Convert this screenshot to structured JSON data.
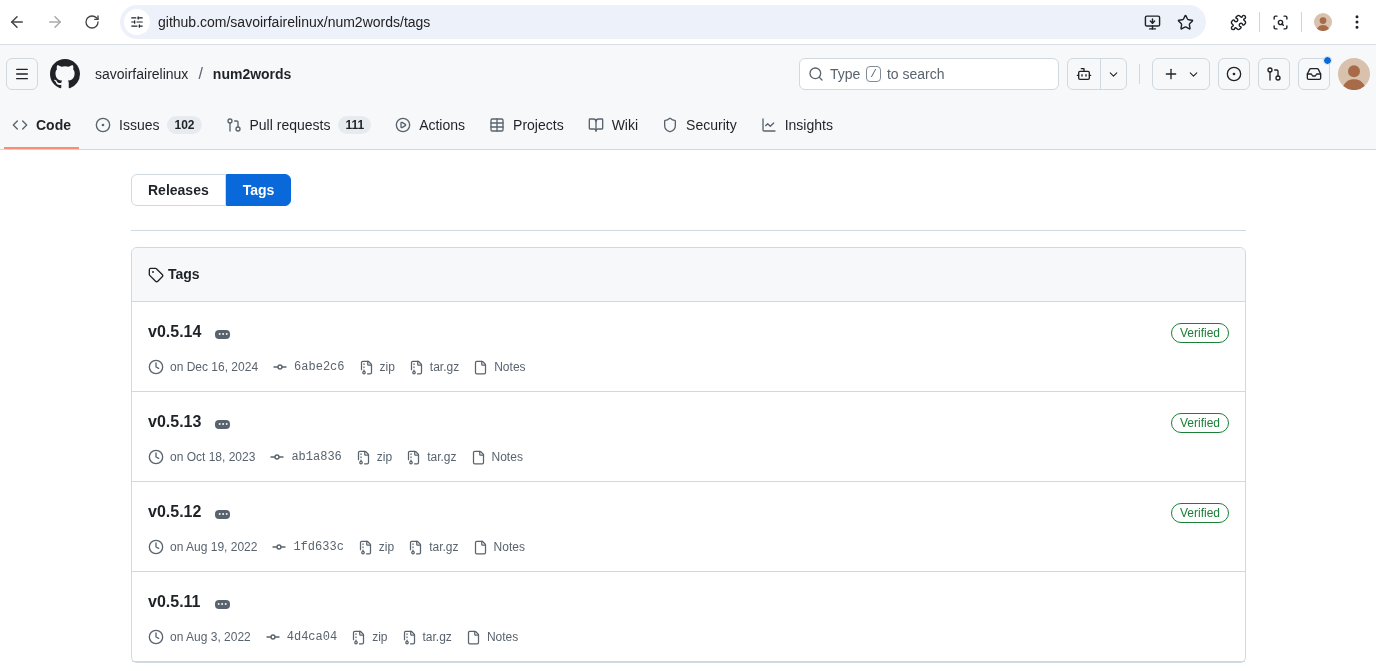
{
  "browser": {
    "url": "github.com/savoirfairelinux/num2words/tags"
  },
  "header": {
    "owner": "savoirfairelinux",
    "separator": "/",
    "repo": "num2words",
    "search": {
      "before": "Type",
      "key": "/",
      "after": "to search"
    },
    "notification_unread": true
  },
  "repo_nav": [
    {
      "kind": "code",
      "label": "Code",
      "selected": true
    },
    {
      "kind": "issues",
      "label": "Issues",
      "count": "102",
      "selected": false
    },
    {
      "kind": "pulls",
      "label": "Pull requests",
      "count": "111",
      "selected": false
    },
    {
      "kind": "actions",
      "label": "Actions",
      "selected": false
    },
    {
      "kind": "projects",
      "label": "Projects",
      "selected": false
    },
    {
      "kind": "wiki",
      "label": "Wiki",
      "selected": false
    },
    {
      "kind": "security",
      "label": "Security",
      "selected": false
    },
    {
      "kind": "insights",
      "label": "Insights",
      "selected": false
    }
  ],
  "toggle": [
    {
      "label": "Releases",
      "selected": false
    },
    {
      "label": "Tags",
      "selected": true
    }
  ],
  "panel": {
    "title": "Tags"
  },
  "tags": [
    {
      "name": "v0.5.14",
      "date": "on Dec 16, 2024",
      "commit": "6abe2c6",
      "zip": "zip",
      "tar": "tar.gz",
      "notes": "Notes",
      "badge": "Verified"
    },
    {
      "name": "v0.5.13",
      "date": "on Oct 18, 2023",
      "commit": "ab1a836",
      "zip": "zip",
      "tar": "tar.gz",
      "notes": "Notes",
      "badge": "Verified"
    },
    {
      "name": "v0.5.12",
      "date": "on Aug 19, 2022",
      "commit": "1fd633c",
      "zip": "zip",
      "tar": "tar.gz",
      "notes": "Notes",
      "badge": "Verified"
    },
    {
      "name": "v0.5.11",
      "date": "on Aug 3, 2022",
      "commit": "4d4ca04",
      "zip": "zip",
      "tar": "tar.gz",
      "notes": "Notes"
    }
  ]
}
